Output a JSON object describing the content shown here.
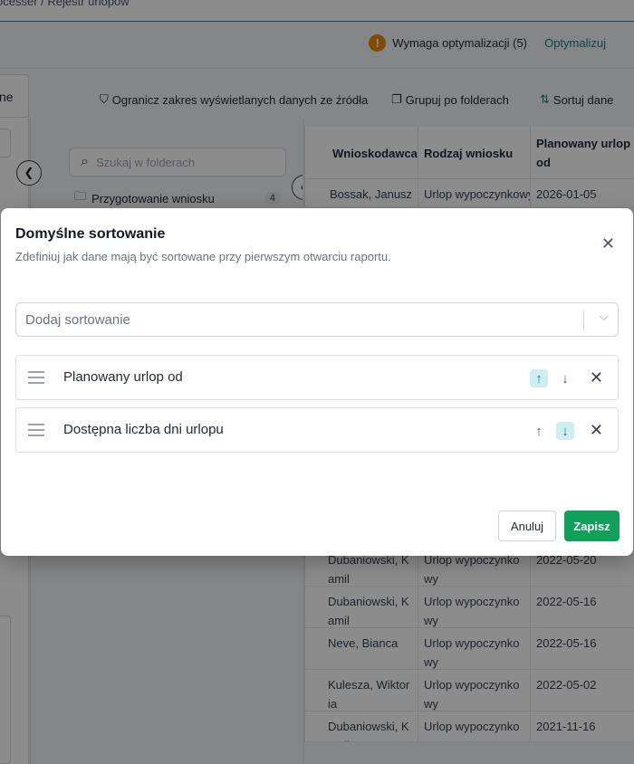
{
  "breadcrumb": {
    "text": "ocesser  /  Rejestr urlopów"
  },
  "topbar": {
    "warning_icon": "!",
    "warning_text": "Wymaga optymalizacji (5)",
    "optimize_label": "Optymalizuj"
  },
  "left_panel": {
    "tab_label": "ne"
  },
  "toolbar": {
    "filter_label": "Ogranicz zakres wyświetlanych danych ze źródła",
    "group_label": "Grupuj po folderach",
    "sort_label": "Sortuj dane"
  },
  "folders": {
    "search_placeholder": "Szukaj w folderach",
    "items": [
      {
        "label": "Przygotowanie wniosku",
        "count": "4"
      }
    ]
  },
  "table": {
    "headers": [
      "Wnioskodawca",
      "Rodzaj wniosku",
      "Planowany urlop od"
    ],
    "rows": [
      {
        "applicant": "Bossak, Janusz",
        "type": "Urlop wypoczynkowy",
        "date": "2026-01-05"
      },
      {
        "applicant": "Dubaniowski, Kamil",
        "type": "Urlop wypoczynkowy",
        "date": "2022-05-20"
      },
      {
        "applicant": "Dubaniowski, Kamil",
        "type": "Urlop wypoczynkowy",
        "date": "2022-05-16"
      },
      {
        "applicant": "Neve, Bianca",
        "type": "Urlop wypoczynkowy",
        "date": "2022-05-16"
      },
      {
        "applicant": "Kulesza, Wiktoria",
        "type": "Urlop wypoczynkowy",
        "date": "2022-05-02"
      },
      {
        "applicant": "Dubaniowski, Kamil",
        "type": "Urlop wypoczynkowy",
        "date": "2021-11-16"
      }
    ]
  },
  "modal": {
    "title": "Domyślne sortowanie",
    "subtitle": "Zdefiniuj jak dane mają być sortowane przy pierwszym otwarciu raportu.",
    "add_sort_placeholder": "Dodaj sortowanie",
    "sort_items": [
      {
        "label": "Planowany urlop od",
        "direction": "ascending"
      },
      {
        "label": "Dostępna liczba dni urlopu",
        "direction": "descending"
      }
    ],
    "cancel_label": "Anuluj",
    "save_label": "Zapisz"
  },
  "colors": {
    "accent": "#1a7f7f",
    "save": "#10a05a",
    "warning": "#e88a0c"
  }
}
